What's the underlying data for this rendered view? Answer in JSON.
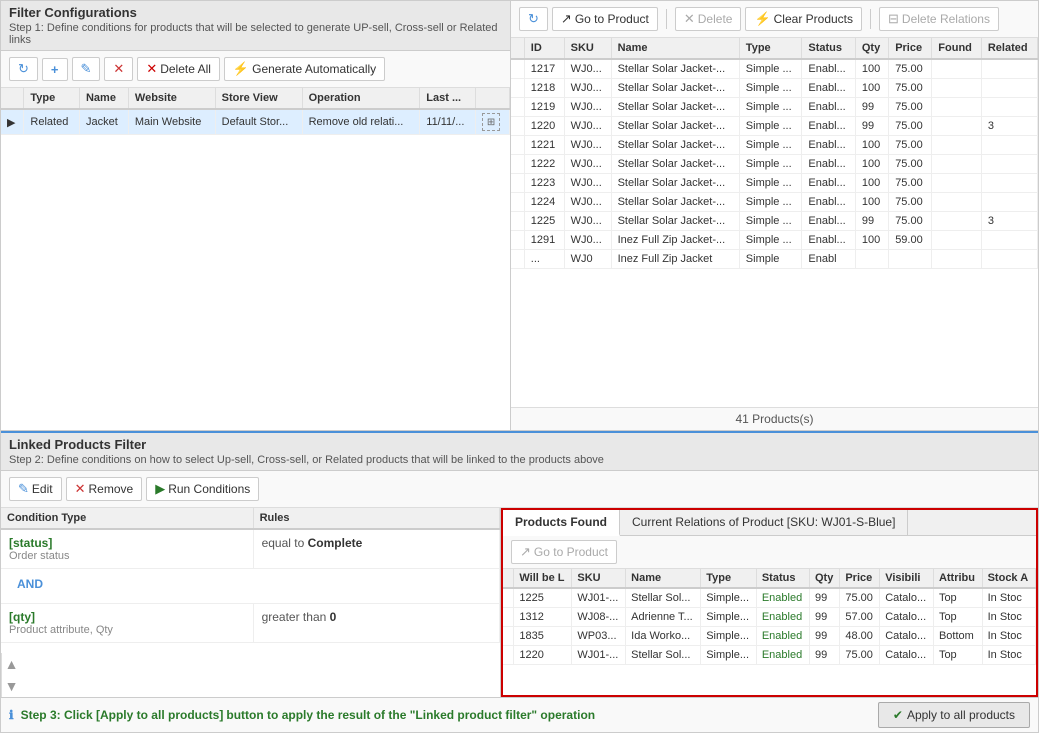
{
  "leftPanel": {
    "title": "Filter Configurations",
    "subtitle": "Step 1: Define conditions for products that will be selected to generate UP-sell, Cross-sell or Related links",
    "toolbar": {
      "refresh": "↻",
      "add": "+",
      "edit": "✎",
      "delete": "✕",
      "deleteAll": "Delete All",
      "generate": "Generate Automatically"
    },
    "tableHeaders": [
      "",
      "Type",
      "Name",
      "Website",
      "Store View",
      "Operation",
      "Last ...",
      ""
    ],
    "rows": [
      {
        "type": "Related",
        "name": "Jacket",
        "website": "Main Website",
        "storeView": "Default Stor...",
        "operation": "Remove old relati...",
        "last": "11/11/..."
      }
    ]
  },
  "rightPanel": {
    "toolbar": {
      "refresh": "↻",
      "goToProduct": "Go to Product",
      "delete": "Delete",
      "clearProducts": "Clear Products",
      "deleteRelations": "Delete Relations"
    },
    "tableHeaders": [
      "",
      "ID",
      "SKU",
      "Name",
      "Type",
      "Status",
      "Qty",
      "Price",
      "Found",
      "Related"
    ],
    "rows": [
      {
        "id": "1217",
        "sku": "WJ0...",
        "name": "Stellar Solar Jacket-...",
        "type": "Simple ...",
        "status": "Enabl...",
        "qty": "100",
        "price": "75.00",
        "found": "",
        "related": ""
      },
      {
        "id": "1218",
        "sku": "WJ0...",
        "name": "Stellar Solar Jacket-...",
        "type": "Simple ...",
        "status": "Enabl...",
        "qty": "100",
        "price": "75.00",
        "found": "",
        "related": ""
      },
      {
        "id": "1219",
        "sku": "WJ0...",
        "name": "Stellar Solar Jacket-...",
        "type": "Simple ...",
        "status": "Enabl...",
        "qty": "99",
        "price": "75.00",
        "found": "",
        "related": ""
      },
      {
        "id": "1220",
        "sku": "WJ0...",
        "name": "Stellar Solar Jacket-...",
        "type": "Simple ...",
        "status": "Enabl...",
        "qty": "99",
        "price": "75.00",
        "found": "",
        "related": "3"
      },
      {
        "id": "1221",
        "sku": "WJ0...",
        "name": "Stellar Solar Jacket-...",
        "type": "Simple ...",
        "status": "Enabl...",
        "qty": "100",
        "price": "75.00",
        "found": "",
        "related": ""
      },
      {
        "id": "1222",
        "sku": "WJ0...",
        "name": "Stellar Solar Jacket-...",
        "type": "Simple ...",
        "status": "Enabl...",
        "qty": "100",
        "price": "75.00",
        "found": "",
        "related": ""
      },
      {
        "id": "1223",
        "sku": "WJ0...",
        "name": "Stellar Solar Jacket-...",
        "type": "Simple ...",
        "status": "Enabl...",
        "qty": "100",
        "price": "75.00",
        "found": "",
        "related": ""
      },
      {
        "id": "1224",
        "sku": "WJ0...",
        "name": "Stellar Solar Jacket-...",
        "type": "Simple ...",
        "status": "Enabl...",
        "qty": "100",
        "price": "75.00",
        "found": "",
        "related": ""
      },
      {
        "id": "1225",
        "sku": "WJ0...",
        "name": "Stellar Solar Jacket-...",
        "type": "Simple ...",
        "status": "Enabl...",
        "qty": "99",
        "price": "75.00",
        "found": "",
        "related": "3"
      },
      {
        "id": "1291",
        "sku": "WJ0...",
        "name": "Inez Full Zip Jacket-...",
        "type": "Simple ...",
        "status": "Enabl...",
        "qty": "100",
        "price": "59.00",
        "found": "",
        "related": ""
      },
      {
        "id": "...",
        "sku": "WJ0",
        "name": "Inez Full Zip Jacket",
        "type": "Simple",
        "status": "Enabl",
        "qty": "",
        "price": "",
        "found": "",
        "related": ""
      }
    ],
    "footer": "41 Products(s)"
  },
  "bottomSection": {
    "title": "Linked Products Filter",
    "subtitle": "Step 2: Define conditions on how to select Up-sell, Cross-sell, or Related products that will be linked to the products above",
    "toolbar": {
      "edit": "Edit",
      "remove": "Remove",
      "runConditions": "Run Conditions"
    },
    "conditions": [
      {
        "type": "[status]",
        "subLabel": "Order status",
        "op": "equal to",
        "val": "Complete"
      },
      {
        "and": "AND"
      },
      {
        "type": "[qty]",
        "subLabel": "Product attribute, Qty",
        "op": "greater than",
        "val": "0"
      }
    ]
  },
  "productsFound": {
    "tabs": [
      "Products Found",
      "Current Relations of Product [SKU: WJ01-S-Blue]"
    ],
    "activeTab": 0,
    "toolbar": {
      "goToProduct": "Go to Product"
    },
    "tableHeaders": [
      "",
      "Will be L",
      "SKU",
      "Name",
      "Type",
      "Status",
      "Qty",
      "Price",
      "Visibili",
      "Attribu",
      "Stock A"
    ],
    "rows": [
      {
        "id": "1225",
        "sku": "WJ01-...",
        "name": "Stellar Sol...",
        "type": "Simple...",
        "status": "Enabled",
        "qty": "99",
        "price": "75.00",
        "visibility": "Catalo...",
        "attribute": "Top",
        "stock": "In Stoc"
      },
      {
        "id": "1312",
        "sku": "WJ08-...",
        "name": "Adrienne T...",
        "type": "Simple...",
        "status": "Enabled",
        "qty": "99",
        "price": "57.00",
        "visibility": "Catalo...",
        "attribute": "Top",
        "stock": "In Stoc"
      },
      {
        "id": "1835",
        "sku": "WP03...",
        "name": "Ida Worko...",
        "type": "Simple...",
        "status": "Enabled",
        "qty": "99",
        "price": "48.00",
        "visibility": "Catalo...",
        "attribute": "Bottom",
        "stock": "In Stoc"
      },
      {
        "id": "1220",
        "sku": "WJ01-...",
        "name": "Stellar Sol...",
        "type": "Simple...",
        "status": "Enabled",
        "qty": "99",
        "price": "75.00",
        "visibility": "Catalo...",
        "attribute": "Top",
        "stock": "In Stoc"
      }
    ]
  },
  "bottomBar": {
    "infoText": "Step 3: Click ",
    "infoLink": "[Apply to all products]",
    "infoSuffix": " button to apply the result of the \"Linked product filter\" operation",
    "applyBtn": "Apply to all products"
  }
}
